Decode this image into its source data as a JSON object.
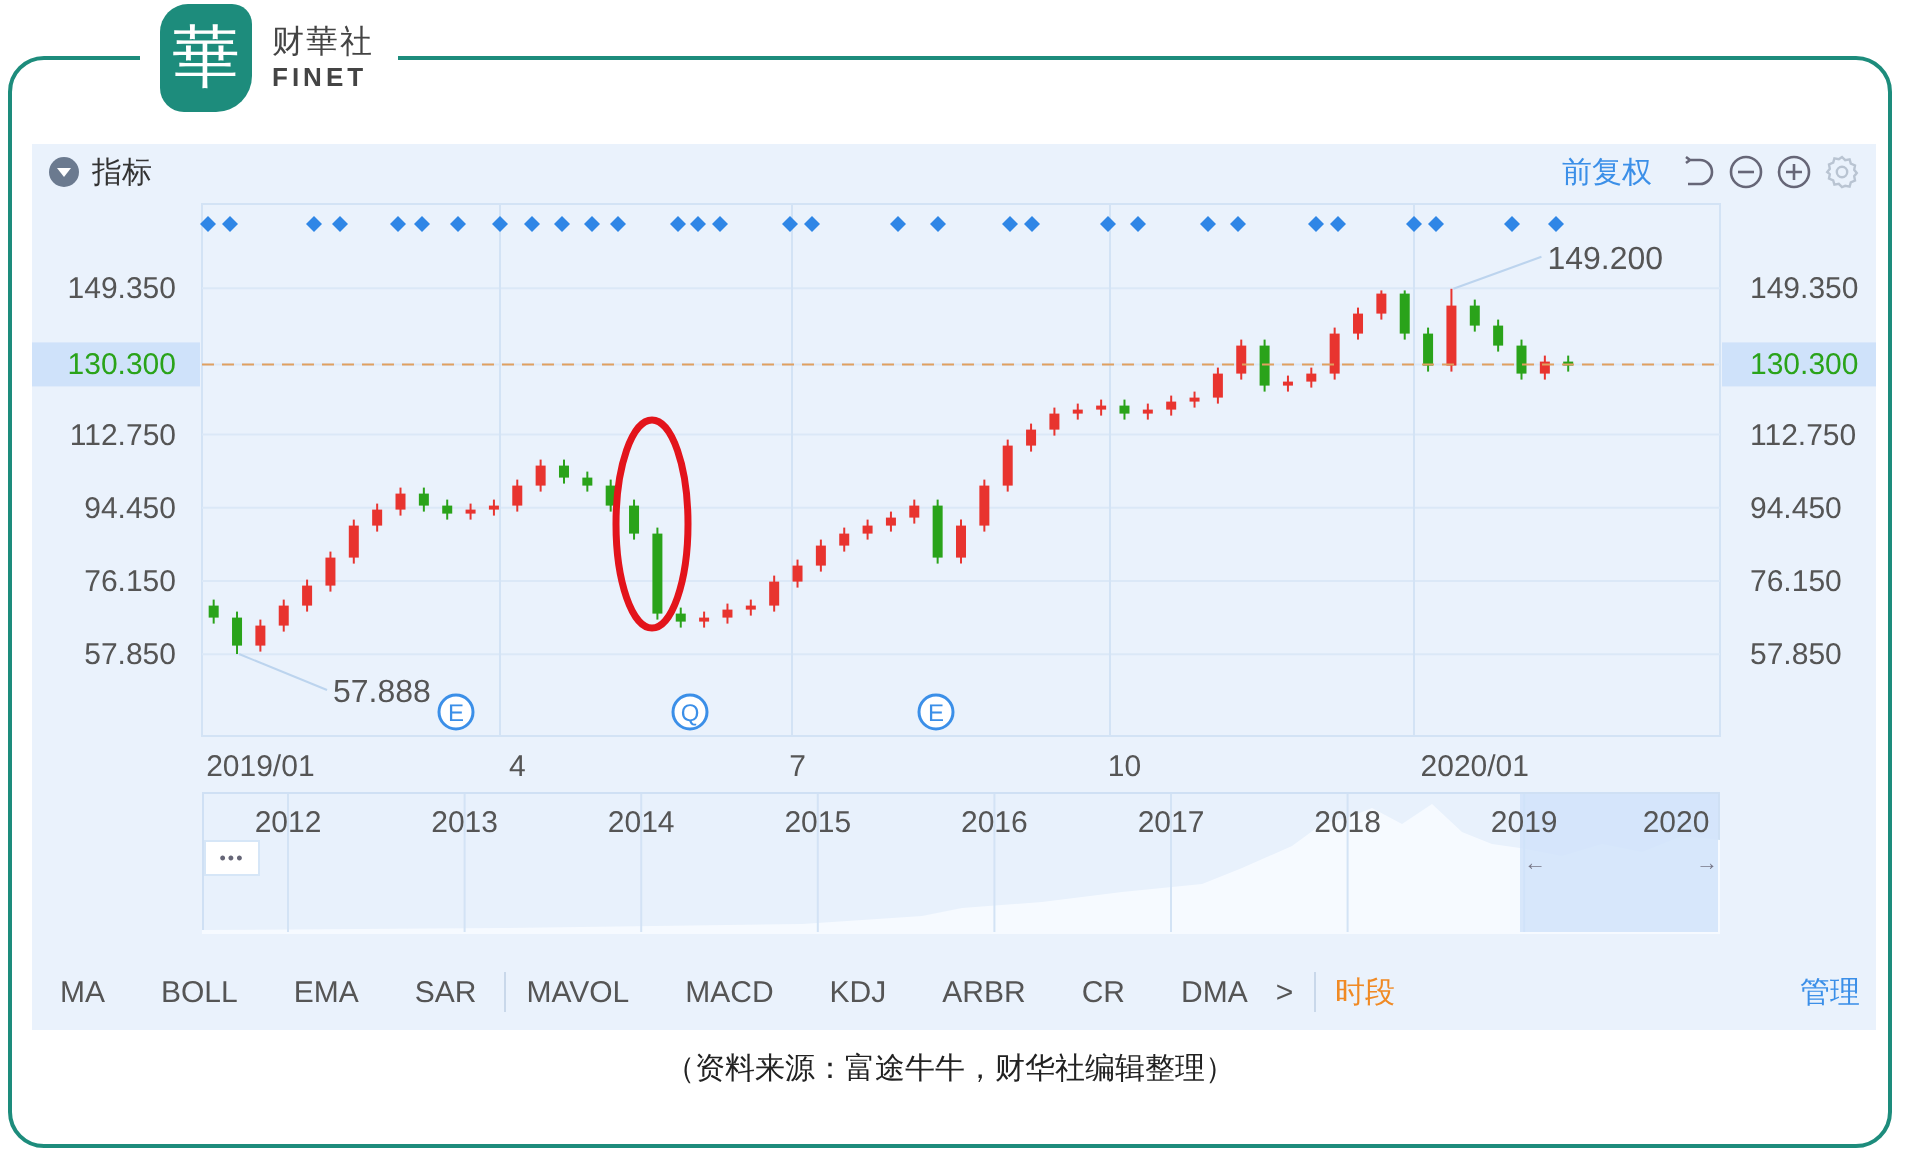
{
  "logo": {
    "mark": "華",
    "name": "财華社",
    "latin": "FINET"
  },
  "header": {
    "title": "指标",
    "adjust": "前复权"
  },
  "chart": {
    "chart_data": {
      "type": "candlestick",
      "grid": true,
      "yticks": [
        {
          "value": 57.85,
          "label": "57.850"
        },
        {
          "value": 76.15,
          "label": "76.150"
        },
        {
          "value": 94.45,
          "label": "94.450"
        },
        {
          "value": 112.75,
          "label": "112.750"
        },
        {
          "value": 130.3,
          "label": "130.300"
        },
        {
          "value": 149.35,
          "label": "149.350"
        }
      ],
      "ylim": [
        37.4,
        170.4
      ],
      "categories": [
        null,
        null,
        "2019/01",
        null,
        null,
        null,
        null,
        null,
        null,
        null,
        null,
        null,
        null,
        "4",
        null,
        null,
        null,
        null,
        null,
        null,
        null,
        null,
        null,
        null,
        null,
        "7",
        null,
        null,
        null,
        null,
        null,
        null,
        null,
        null,
        null,
        null,
        null,
        null,
        null,
        "10",
        null,
        null,
        null,
        null,
        null,
        null,
        null,
        null,
        null,
        null,
        null,
        null,
        null,
        null,
        "2020/01",
        null,
        null,
        null,
        null,
        null,
        null,
        null,
        null,
        null,
        null
      ],
      "ohlc": [
        [
          70,
          71.5,
          65.5,
          67
        ],
        [
          67,
          68.5,
          57.888,
          60
        ],
        [
          60,
          66.5,
          58.5,
          65
        ],
        [
          65,
          71.5,
          63.5,
          70
        ],
        [
          70,
          76.5,
          68.5,
          75
        ],
        [
          75,
          83.5,
          73.5,
          82
        ],
        [
          82,
          91.5,
          80.5,
          90
        ],
        [
          90,
          95.5,
          88.5,
          94
        ],
        [
          94,
          99.5,
          92.5,
          98
        ],
        [
          98,
          99.5,
          93.5,
          95
        ],
        [
          95,
          96.5,
          91.5,
          93
        ],
        [
          93,
          95.5,
          91.5,
          94
        ],
        [
          94,
          96.5,
          92.5,
          95
        ],
        [
          95,
          101.5,
          93.5,
          100
        ],
        [
          100,
          106.5,
          98.5,
          105
        ],
        [
          105,
          106.5,
          100.5,
          102
        ],
        [
          102,
          103.5,
          98.5,
          100
        ],
        [
          100,
          101.5,
          93.5,
          95
        ],
        [
          95,
          96.5,
          86.5,
          88
        ],
        [
          88,
          89.5,
          66.5,
          68
        ],
        [
          68,
          69.5,
          64.5,
          66
        ],
        [
          66,
          68.5,
          64.5,
          67
        ],
        [
          67,
          70.5,
          65.5,
          69
        ],
        [
          69,
          71.5,
          67.5,
          70
        ],
        [
          70,
          77.5,
          68.5,
          76
        ],
        [
          76,
          81.5,
          74.5,
          80
        ],
        [
          80,
          86.5,
          78.5,
          85
        ],
        [
          85,
          89.5,
          83.5,
          88
        ],
        [
          88,
          91.5,
          86.5,
          90
        ],
        [
          90,
          93.5,
          88.5,
          92
        ],
        [
          92,
          96.5,
          90.5,
          95
        ],
        [
          95,
          96.5,
          80.5,
          82
        ],
        [
          82,
          91.5,
          80.5,
          90
        ],
        [
          90,
          101.5,
          88.5,
          100
        ],
        [
          100,
          111.5,
          98.5,
          110
        ],
        [
          110,
          115.5,
          108.5,
          114
        ],
        [
          114,
          119.5,
          112.5,
          118
        ],
        [
          118,
          120.5,
          116.5,
          119
        ],
        [
          119,
          121.5,
          117.5,
          120
        ],
        [
          120,
          121.5,
          116.5,
          118
        ],
        [
          118,
          120.5,
          116.5,
          119
        ],
        [
          119,
          122.5,
          117.5,
          121
        ],
        [
          121,
          123.5,
          119.5,
          122
        ],
        [
          122,
          129.5,
          120.5,
          128
        ],
        [
          128,
          136.5,
          126.5,
          135
        ],
        [
          135,
          136.5,
          123.5,
          125
        ],
        [
          125,
          127.5,
          123.5,
          126
        ],
        [
          126,
          129.5,
          124.5,
          128
        ],
        [
          128,
          139.5,
          126.5,
          138
        ],
        [
          138,
          144.5,
          136.5,
          143
        ],
        [
          143,
          148.8,
          141.5,
          148
        ],
        [
          148,
          148.8,
          136.5,
          138
        ],
        [
          138,
          139.5,
          128.5,
          130
        ],
        [
          130,
          149.2,
          128.5,
          145
        ],
        [
          145,
          146.5,
          138.5,
          140
        ],
        [
          140,
          141.5,
          133.5,
          135
        ],
        [
          135,
          136.5,
          126.5,
          128
        ],
        [
          128,
          132.5,
          126.5,
          131
        ],
        [
          131,
          132.5,
          128.5,
          130
        ],
        null,
        null,
        null,
        null,
        null,
        null
      ],
      "ref_lines": [
        {
          "axis": "y",
          "value": 130.3,
          "color": "#e0a060"
        }
      ],
      "annotations": [
        "149.200",
        "57.888"
      ]
    },
    "events": [
      {
        "label": "E"
      },
      {
        "label": "Q"
      },
      {
        "label": "E"
      }
    ]
  },
  "navigator": {
    "years": [
      "2012",
      "2013",
      "2014",
      "2015",
      "2016",
      "2017",
      "2018",
      "2019",
      "2020"
    ],
    "more_button": "•••",
    "left_handle": "←",
    "right_handle": "→"
  },
  "toolbar": {
    "main_indicators": [
      "MA",
      "BOLL",
      "EMA",
      "SAR"
    ],
    "sub_indicators": [
      "MAVOL",
      "MACD",
      "KDJ",
      "ARBR",
      "CR",
      "DMA"
    ],
    "more": ">",
    "period": "时段",
    "manage": "管理"
  },
  "caption": "（资料来源：富途牛牛，财华社编辑整理）"
}
